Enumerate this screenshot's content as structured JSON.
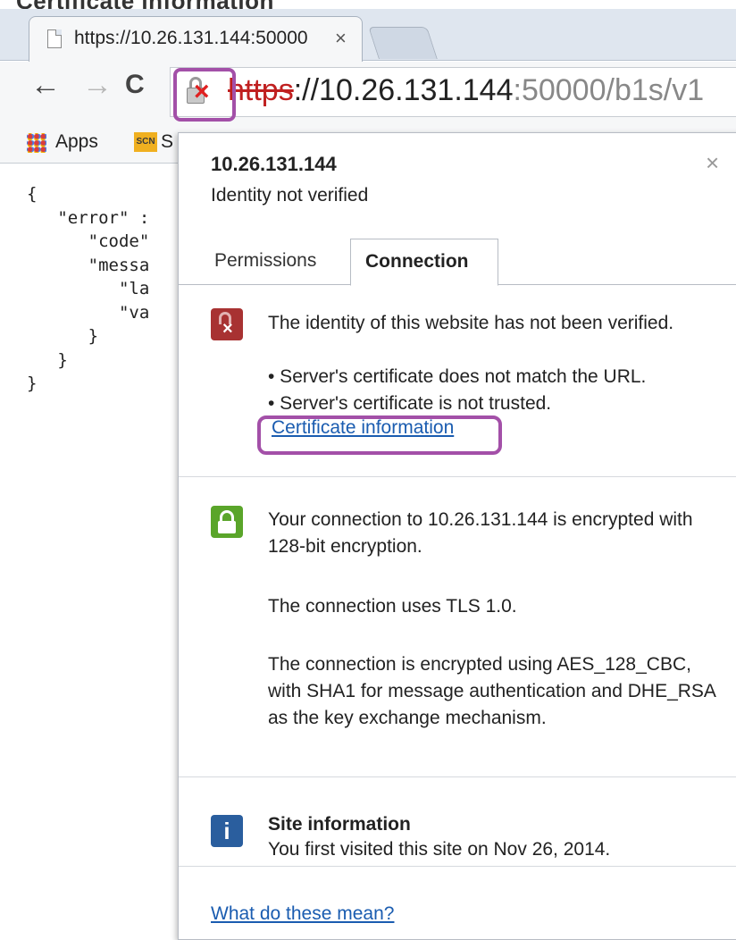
{
  "caption": "Certificate information",
  "browser": {
    "tab_title": "https://10.26.131.144:50000",
    "tab_close": "×",
    "url_scheme": "https",
    "url_host": "://10.26.131.144",
    "url_rest": ":50000/b1s/v1",
    "nav_back": "←",
    "nav_forward": "→",
    "nav_reload": "C"
  },
  "bookmarks": {
    "apps_label": "Apps",
    "scn_icon": "SCN",
    "scn_label": "S"
  },
  "page": {
    "json_lines": [
      "{",
      "   \"error\" :",
      "      \"code\"",
      "      \"messa",
      "         \"la",
      "         \"va",
      "      }",
      "   }",
      "}"
    ]
  },
  "popup": {
    "host": "10.26.131.144",
    "identity_status": "Identity not verified",
    "close": "×",
    "tabs": [
      "Permissions",
      "Connection"
    ],
    "identity_message": "The identity of this website has not been verified.",
    "bullets": [
      "• Server's certificate does not match the URL.",
      "• Server's certificate is not trusted."
    ],
    "cert_link": "Certificate information",
    "encryption_message": "Your connection to 10.26.131.144 is encrypted with 128-bit encryption.",
    "tls_message": "The connection uses TLS 1.0.",
    "cipher_message": "The connection is encrypted using AES_128_CBC, with SHA1 for message authentication and DHE_RSA as the key exchange mechanism.",
    "site_info_title": "Site information",
    "site_info_text": "You first visited this site on Nov 26, 2014.",
    "help_link": "What do these mean?",
    "info_icon": "i"
  },
  "colors": {
    "highlight": "#a350a8",
    "link": "#1a5cb0",
    "bad": "#a83232",
    "good": "#5aa52a",
    "info": "#2a5e9e"
  }
}
